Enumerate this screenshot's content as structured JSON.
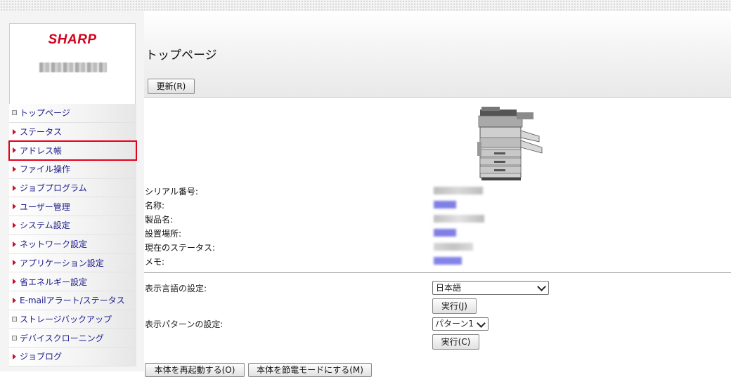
{
  "brand": {
    "logo_text": "SHARP"
  },
  "nav": {
    "items": [
      {
        "label": "トップページ",
        "bullet": "square"
      },
      {
        "label": "ステータス",
        "bullet": "triangle"
      },
      {
        "label": "アドレス帳",
        "bullet": "triangle",
        "selected": true
      },
      {
        "label": "ファイル操作",
        "bullet": "triangle"
      },
      {
        "label": "ジョブプログラム",
        "bullet": "triangle"
      },
      {
        "label": "ユーザー管理",
        "bullet": "triangle"
      },
      {
        "label": "システム設定",
        "bullet": "triangle"
      },
      {
        "label": "ネットワーク設定",
        "bullet": "triangle"
      },
      {
        "label": "アプリケーション設定",
        "bullet": "triangle"
      },
      {
        "label": "省エネルギー設定",
        "bullet": "triangle"
      },
      {
        "label": "E-mailアラート/ステータス",
        "bullet": "triangle"
      },
      {
        "label": "ストレージバックアップ",
        "bullet": "square"
      },
      {
        "label": "デバイスクローニング",
        "bullet": "square"
      },
      {
        "label": "ジョブログ",
        "bullet": "triangle"
      }
    ]
  },
  "header": {
    "page_title": "トップページ",
    "refresh_label": "更新(R)"
  },
  "device_info": {
    "rows": [
      {
        "label": "シリアル番号:"
      },
      {
        "label": "名称:"
      },
      {
        "label": "製品名:"
      },
      {
        "label": "設置場所:"
      },
      {
        "label": "現在のステータス:"
      },
      {
        "label": "メモ:"
      }
    ]
  },
  "settings": {
    "language_label": "表示言語の設定:",
    "language_value": "日本語",
    "language_exec": "実行(J)",
    "pattern_label": "表示パターンの設定:",
    "pattern_value": "パターン1",
    "pattern_exec": "実行(C)"
  },
  "footer": {
    "restart_label": "本体を再起動する(O)",
    "power_save_label": "本体を節電モードにする(M)"
  },
  "colors": {
    "brand_red": "#d5001c",
    "nav_link": "#1a1a8c",
    "selected_outline": "#e4001b"
  }
}
